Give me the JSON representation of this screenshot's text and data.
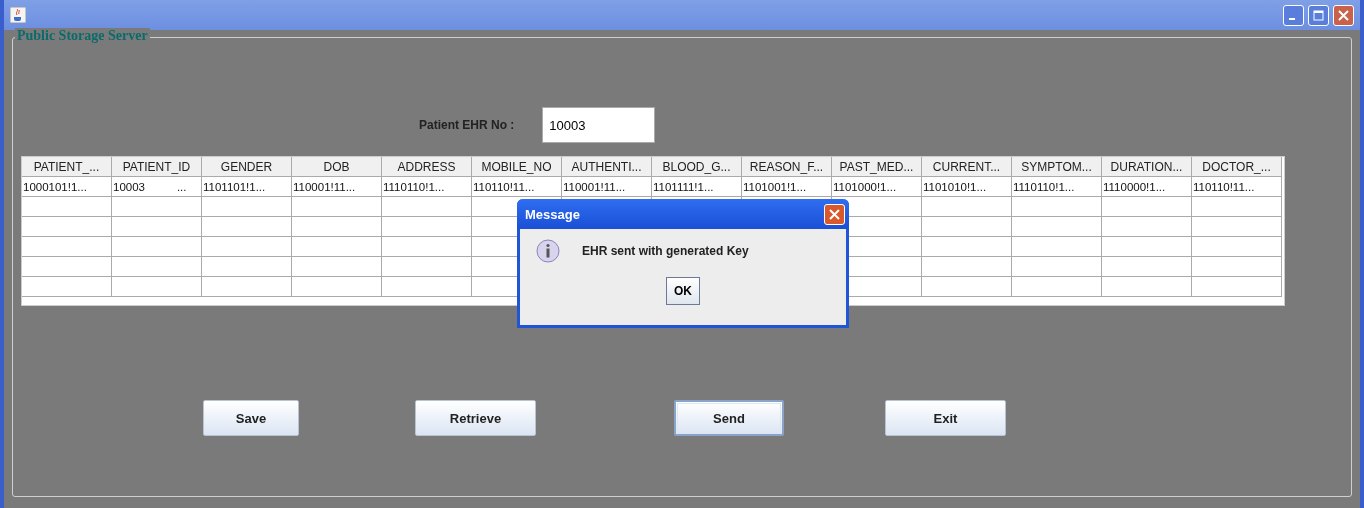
{
  "panel": {
    "title": "Public Storage Server"
  },
  "ehr_field": {
    "label": "Patient EHR No :",
    "value": "10003"
  },
  "table": {
    "columns": [
      "PATIENT_...",
      "PATIENT_ID",
      "GENDER",
      "DOB",
      "ADDRESS",
      "MOBILE_NO",
      "AUTHENTI...",
      "BLOOD_G...",
      "REASON_F...",
      "PAST_MED...",
      "CURRENT...",
      "SYMPTOM...",
      "DURATION...",
      "DOCTOR_..."
    ],
    "rows": [
      [
        "1000101!1...",
        "10003          ...",
        "1101101!1...",
        "110001!11...",
        "1110110!1...",
        "110110!11...",
        "110001!11...",
        "1101111!1...",
        "1101001!1...",
        "1101000!1...",
        "1101010!1...",
        "1110110!1...",
        "1110000!1...",
        "110110!11..."
      ]
    ]
  },
  "buttons": [
    {
      "label": "Save",
      "focused": false
    },
    {
      "label": "Retrieve",
      "focused": false
    },
    {
      "label": "Send",
      "focused": true
    },
    {
      "label": "Exit",
      "focused": false
    }
  ],
  "dialog": {
    "title": "Message",
    "message": "EHR sent with generated Key",
    "button": "OK"
  }
}
